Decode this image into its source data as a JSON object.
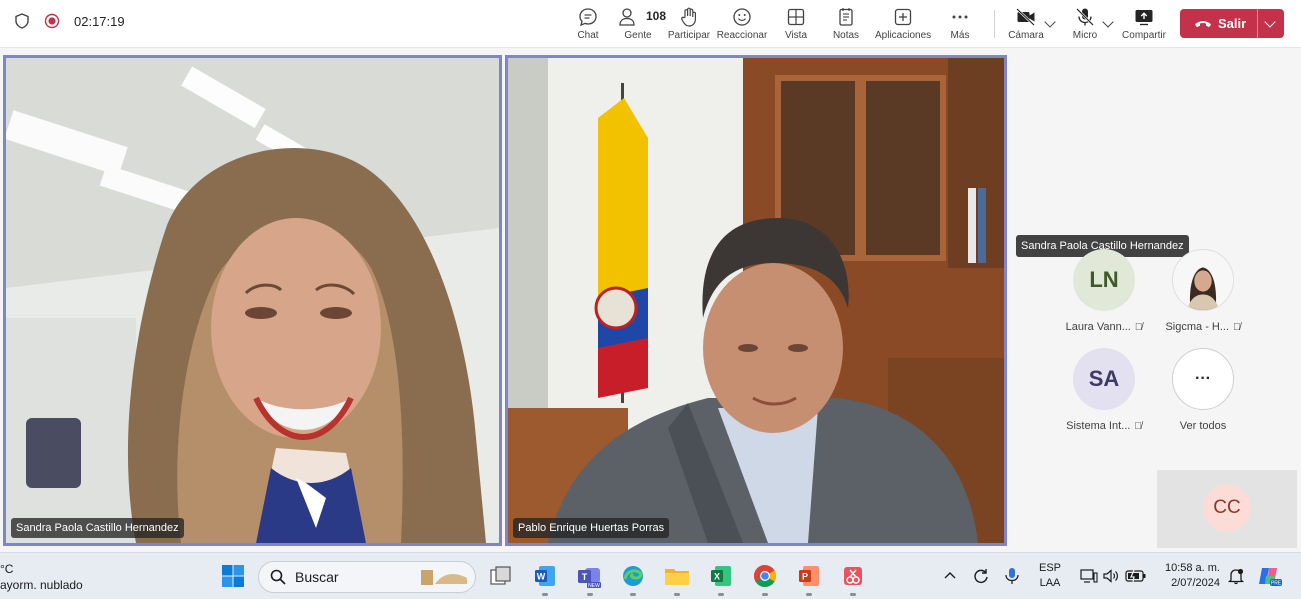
{
  "meeting": {
    "timer": "02:17:19"
  },
  "toolbar": {
    "chat": "Chat",
    "people": "Gente",
    "people_count": "108",
    "raise": "Participar",
    "react": "Reaccionar",
    "view": "Vista",
    "notes": "Notas",
    "apps": "Aplicaciones",
    "more": "Más",
    "camera": "Cámara",
    "mic": "Micro",
    "share": "Compartir",
    "leave": "Salir",
    "leave_color": "#c4314b"
  },
  "tiles": [
    {
      "name": "Sandra Paola Castillo Hernandez"
    },
    {
      "name": "Pablo Enrique Huertas Porras"
    }
  ],
  "tooltip": "Sandra Paola Castillo Hernandez",
  "participants": [
    {
      "initials": "LN",
      "name": "Laura Vann...",
      "muted": true
    },
    {
      "initials": "",
      "name": "Sigcma - H...",
      "muted": true
    },
    {
      "initials": "SA",
      "name": "Sistema Int...",
      "muted": true
    },
    {
      "initials": "···",
      "name": "Ver todos",
      "muted": false
    }
  ],
  "self_initials": "CC",
  "taskbar": {
    "weather_temp": "°C",
    "weather_desc": "ayorm. nublado",
    "search_placeholder": "Buscar",
    "lang_1": "ESP",
    "lang_2": "LAA",
    "time": "10:58 a. m.",
    "date": "2/07/2024"
  },
  "accent_color": "#7f85c5"
}
